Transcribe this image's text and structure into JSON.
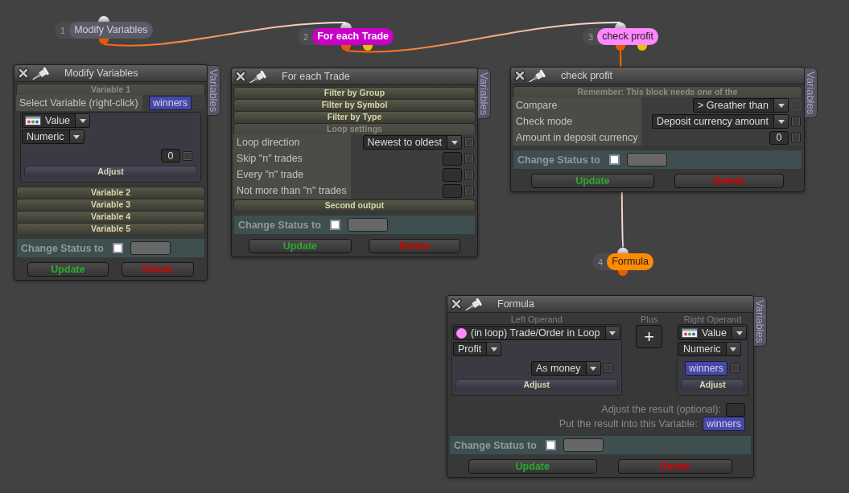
{
  "nodes": [
    {
      "number": "1",
      "label": "Modify Variables",
      "color": "#5b5a68",
      "outputs": [
        {
          "kind": "main"
        }
      ],
      "linked": true
    },
    {
      "number": "2",
      "label": "For each Trade",
      "color": "#c800c8",
      "outputs": [
        {
          "kind": "main"
        },
        {
          "kind": "second"
        }
      ],
      "linked": true
    },
    {
      "number": "3",
      "label": "check profit",
      "color": "#ff88ff",
      "outputs": [
        {
          "kind": "main"
        },
        {
          "kind": "second"
        }
      ],
      "linked": true
    },
    {
      "number": "4",
      "label": "Formula",
      "color": "#ff8c00",
      "outputs": [
        {
          "kind": "main"
        }
      ],
      "linked": false
    }
  ],
  "panels": [
    {
      "title": "Modify Variables",
      "side_tab": "Variables",
      "body": [
        {
          "kind": "bar",
          "label": "Variable 1",
          "expanded": true
        },
        {
          "kind": "row",
          "label": "Select Variable (right-click)",
          "control": {
            "kind": "chip",
            "value": "winners"
          },
          "checkbox": {
            "checked": false,
            "disabled": true
          }
        },
        {
          "kind": "operand",
          "items": [
            {
              "kind": "source",
              "value": "Value"
            },
            {
              "kind": "dropdown",
              "value": "Numeric"
            },
            {
              "kind": "input",
              "value": "0",
              "checkbox": {
                "checked": false,
                "disabled": false
              }
            },
            {
              "kind": "adjust",
              "label": "Adjust"
            }
          ]
        },
        {
          "kind": "bar",
          "label": "Variable 2",
          "expanded": false
        },
        {
          "kind": "bar",
          "label": "Variable 3",
          "expanded": false
        },
        {
          "kind": "bar",
          "label": "Variable 4",
          "expanded": false
        },
        {
          "kind": "bar",
          "label": "Variable 5",
          "expanded": false
        }
      ],
      "status": {
        "label": "Change Status to",
        "checked": false
      },
      "buttons": [
        {
          "kind": "update",
          "label": "Update"
        },
        {
          "kind": "delete",
          "label": "Delete"
        }
      ]
    },
    {
      "title": "For each Trade",
      "side_tab": "Variables",
      "body": [
        {
          "kind": "bar",
          "label": "Filter by Group",
          "expanded": false
        },
        {
          "kind": "bar",
          "label": "Filter by Symbol",
          "expanded": false
        },
        {
          "kind": "bar",
          "label": "Filter by Type",
          "expanded": false
        },
        {
          "kind": "bar",
          "label": "Loop settings",
          "expanded": true
        },
        {
          "kind": "row",
          "label": "Loop direction",
          "control": {
            "kind": "dropdown",
            "value": "Newest to oldest"
          },
          "checkbox": {
            "checked": false,
            "disabled": false
          }
        },
        {
          "kind": "row",
          "label": "Skip \"n\" trades",
          "control": {
            "kind": "input"
          },
          "checkbox": {
            "checked": false,
            "disabled": false
          }
        },
        {
          "kind": "row",
          "label": "Every \"n\" trade",
          "control": {
            "kind": "input"
          },
          "checkbox": {
            "checked": false,
            "disabled": false
          }
        },
        {
          "kind": "row",
          "label": "Not more than \"n\" trades",
          "control": {
            "kind": "input"
          },
          "checkbox": {
            "checked": false,
            "disabled": false
          }
        },
        {
          "kind": "bar",
          "label": "Second output",
          "expanded": false
        }
      ],
      "status": {
        "label": "Change Status to",
        "checked": false
      },
      "buttons": [
        {
          "kind": "update",
          "label": "Update"
        },
        {
          "kind": "delete",
          "label": "Delete"
        }
      ]
    },
    {
      "title": "check profit",
      "side_tab": "Variables",
      "body": [
        {
          "kind": "bar",
          "label": "Remember: This block needs one of the",
          "expanded": true
        },
        {
          "kind": "row",
          "label": "Compare",
          "control": {
            "kind": "dropdown",
            "value": "> Greather than"
          },
          "checkbox": {
            "checked": false,
            "disabled": true
          }
        },
        {
          "kind": "row",
          "label": "Check mode",
          "control": {
            "kind": "dropdown",
            "value": "Deposit currency amount"
          },
          "checkbox": {
            "checked": false,
            "disabled": false
          }
        },
        {
          "kind": "row",
          "label": "Amount in deposit currency",
          "control": {
            "kind": "input",
            "value": "0"
          },
          "checkbox": {
            "checked": false,
            "disabled": false
          }
        }
      ],
      "status": {
        "label": "Change Status to",
        "checked": false
      },
      "buttons": [
        {
          "kind": "update",
          "label": "Update"
        },
        {
          "kind": "delete",
          "label": "Delete"
        }
      ]
    },
    {
      "title": "Formula",
      "side_tab": "Variables",
      "body": [
        {
          "kind": "formula",
          "left": {
            "caption": "Left Operand",
            "items": [
              {
                "kind": "source",
                "value": "(in loop) Trade/Order in Loop",
                "color": "#ff88ff"
              },
              {
                "kind": "dropdown",
                "value": "Profit"
              },
              {
                "kind": "dropdown",
                "value": "As money",
                "checkbox": {
                  "checked": false,
                  "disabled": false
                }
              },
              {
                "kind": "adjust",
                "label": "Adjust"
              }
            ]
          },
          "operator": {
            "caption": "Plus",
            "symbol": "+"
          },
          "right": {
            "caption": "Right Operand",
            "items": [
              {
                "kind": "source",
                "value": "Value"
              },
              {
                "kind": "dropdown",
                "value": "Numeric"
              },
              {
                "kind": "chip",
                "value": "winners",
                "checkbox": {
                  "checked": false,
                  "disabled": false
                }
              },
              {
                "kind": "adjust",
                "label": "Adjust"
              }
            ]
          }
        },
        {
          "kind": "result_row",
          "label": "Adjust the result (optional):",
          "control": {
            "kind": "input"
          }
        },
        {
          "kind": "result_row",
          "label": "Put the result into this Variable:",
          "control": {
            "kind": "chip",
            "value": "winners"
          }
        }
      ],
      "status": {
        "label": "Change Status to",
        "checked": false
      },
      "buttons": [
        {
          "kind": "update",
          "label": "Update"
        },
        {
          "kind": "delete",
          "label": "Delete"
        }
      ]
    }
  ]
}
